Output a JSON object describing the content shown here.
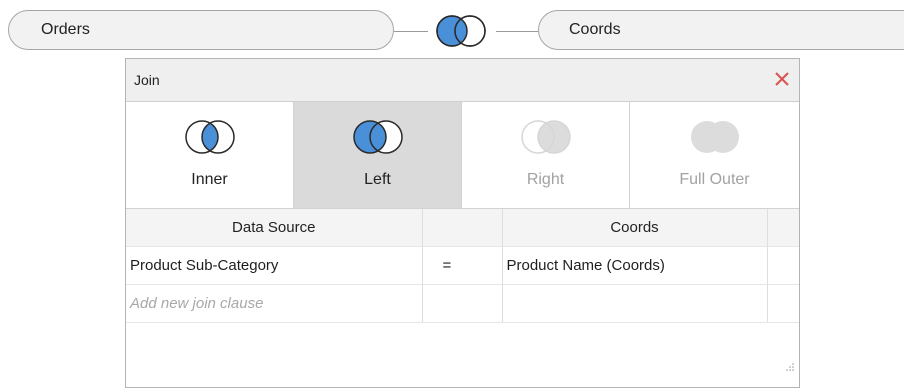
{
  "join_bar": {
    "left_table": "Orders",
    "right_table": "Coords",
    "join_kind_icon": "left-join-icon"
  },
  "panel": {
    "title": "Join",
    "close_icon": "close-icon",
    "join_types": [
      {
        "label": "Inner",
        "icon": "inner-join-icon",
        "selected": false,
        "enabled": true
      },
      {
        "label": "Left",
        "icon": "left-join-icon",
        "selected": true,
        "enabled": true
      },
      {
        "label": "Right",
        "icon": "right-join-icon",
        "selected": false,
        "enabled": false
      },
      {
        "label": "Full Outer",
        "icon": "full-outer-join-icon",
        "selected": false,
        "enabled": false
      }
    ],
    "columns": [
      "Data Source",
      "",
      "Coords",
      ""
    ],
    "rows": [
      {
        "left": "Product Sub-Category",
        "operator": "=",
        "right": "Product Name (Coords)"
      }
    ],
    "add_clause_placeholder": "Add new join clause"
  },
  "colors": {
    "accent": "#4a90d9",
    "close": "#d9534f",
    "disabled": "#d8d8d8",
    "selected_bg": "#dadada"
  }
}
